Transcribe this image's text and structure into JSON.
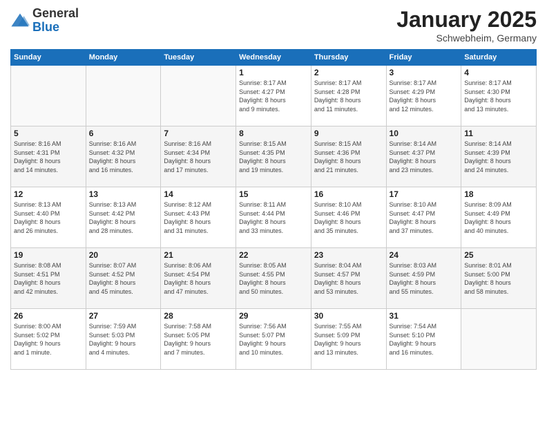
{
  "logo": {
    "general": "General",
    "blue": "Blue"
  },
  "header": {
    "month": "January 2025",
    "location": "Schwebheim, Germany"
  },
  "weekdays": [
    "Sunday",
    "Monday",
    "Tuesday",
    "Wednesday",
    "Thursday",
    "Friday",
    "Saturday"
  ],
  "weeks": [
    [
      {
        "day": "",
        "info": ""
      },
      {
        "day": "",
        "info": ""
      },
      {
        "day": "",
        "info": ""
      },
      {
        "day": "1",
        "info": "Sunrise: 8:17 AM\nSunset: 4:27 PM\nDaylight: 8 hours\nand 9 minutes."
      },
      {
        "day": "2",
        "info": "Sunrise: 8:17 AM\nSunset: 4:28 PM\nDaylight: 8 hours\nand 11 minutes."
      },
      {
        "day": "3",
        "info": "Sunrise: 8:17 AM\nSunset: 4:29 PM\nDaylight: 8 hours\nand 12 minutes."
      },
      {
        "day": "4",
        "info": "Sunrise: 8:17 AM\nSunset: 4:30 PM\nDaylight: 8 hours\nand 13 minutes."
      }
    ],
    [
      {
        "day": "5",
        "info": "Sunrise: 8:16 AM\nSunset: 4:31 PM\nDaylight: 8 hours\nand 14 minutes."
      },
      {
        "day": "6",
        "info": "Sunrise: 8:16 AM\nSunset: 4:32 PM\nDaylight: 8 hours\nand 16 minutes."
      },
      {
        "day": "7",
        "info": "Sunrise: 8:16 AM\nSunset: 4:34 PM\nDaylight: 8 hours\nand 17 minutes."
      },
      {
        "day": "8",
        "info": "Sunrise: 8:15 AM\nSunset: 4:35 PM\nDaylight: 8 hours\nand 19 minutes."
      },
      {
        "day": "9",
        "info": "Sunrise: 8:15 AM\nSunset: 4:36 PM\nDaylight: 8 hours\nand 21 minutes."
      },
      {
        "day": "10",
        "info": "Sunrise: 8:14 AM\nSunset: 4:37 PM\nDaylight: 8 hours\nand 23 minutes."
      },
      {
        "day": "11",
        "info": "Sunrise: 8:14 AM\nSunset: 4:39 PM\nDaylight: 8 hours\nand 24 minutes."
      }
    ],
    [
      {
        "day": "12",
        "info": "Sunrise: 8:13 AM\nSunset: 4:40 PM\nDaylight: 8 hours\nand 26 minutes."
      },
      {
        "day": "13",
        "info": "Sunrise: 8:13 AM\nSunset: 4:42 PM\nDaylight: 8 hours\nand 28 minutes."
      },
      {
        "day": "14",
        "info": "Sunrise: 8:12 AM\nSunset: 4:43 PM\nDaylight: 8 hours\nand 31 minutes."
      },
      {
        "day": "15",
        "info": "Sunrise: 8:11 AM\nSunset: 4:44 PM\nDaylight: 8 hours\nand 33 minutes."
      },
      {
        "day": "16",
        "info": "Sunrise: 8:10 AM\nSunset: 4:46 PM\nDaylight: 8 hours\nand 35 minutes."
      },
      {
        "day": "17",
        "info": "Sunrise: 8:10 AM\nSunset: 4:47 PM\nDaylight: 8 hours\nand 37 minutes."
      },
      {
        "day": "18",
        "info": "Sunrise: 8:09 AM\nSunset: 4:49 PM\nDaylight: 8 hours\nand 40 minutes."
      }
    ],
    [
      {
        "day": "19",
        "info": "Sunrise: 8:08 AM\nSunset: 4:51 PM\nDaylight: 8 hours\nand 42 minutes."
      },
      {
        "day": "20",
        "info": "Sunrise: 8:07 AM\nSunset: 4:52 PM\nDaylight: 8 hours\nand 45 minutes."
      },
      {
        "day": "21",
        "info": "Sunrise: 8:06 AM\nSunset: 4:54 PM\nDaylight: 8 hours\nand 47 minutes."
      },
      {
        "day": "22",
        "info": "Sunrise: 8:05 AM\nSunset: 4:55 PM\nDaylight: 8 hours\nand 50 minutes."
      },
      {
        "day": "23",
        "info": "Sunrise: 8:04 AM\nSunset: 4:57 PM\nDaylight: 8 hours\nand 53 minutes."
      },
      {
        "day": "24",
        "info": "Sunrise: 8:03 AM\nSunset: 4:59 PM\nDaylight: 8 hours\nand 55 minutes."
      },
      {
        "day": "25",
        "info": "Sunrise: 8:01 AM\nSunset: 5:00 PM\nDaylight: 8 hours\nand 58 minutes."
      }
    ],
    [
      {
        "day": "26",
        "info": "Sunrise: 8:00 AM\nSunset: 5:02 PM\nDaylight: 9 hours\nand 1 minute."
      },
      {
        "day": "27",
        "info": "Sunrise: 7:59 AM\nSunset: 5:03 PM\nDaylight: 9 hours\nand 4 minutes."
      },
      {
        "day": "28",
        "info": "Sunrise: 7:58 AM\nSunset: 5:05 PM\nDaylight: 9 hours\nand 7 minutes."
      },
      {
        "day": "29",
        "info": "Sunrise: 7:56 AM\nSunset: 5:07 PM\nDaylight: 9 hours\nand 10 minutes."
      },
      {
        "day": "30",
        "info": "Sunrise: 7:55 AM\nSunset: 5:09 PM\nDaylight: 9 hours\nand 13 minutes."
      },
      {
        "day": "31",
        "info": "Sunrise: 7:54 AM\nSunset: 5:10 PM\nDaylight: 9 hours\nand 16 minutes."
      },
      {
        "day": "",
        "info": ""
      }
    ]
  ]
}
